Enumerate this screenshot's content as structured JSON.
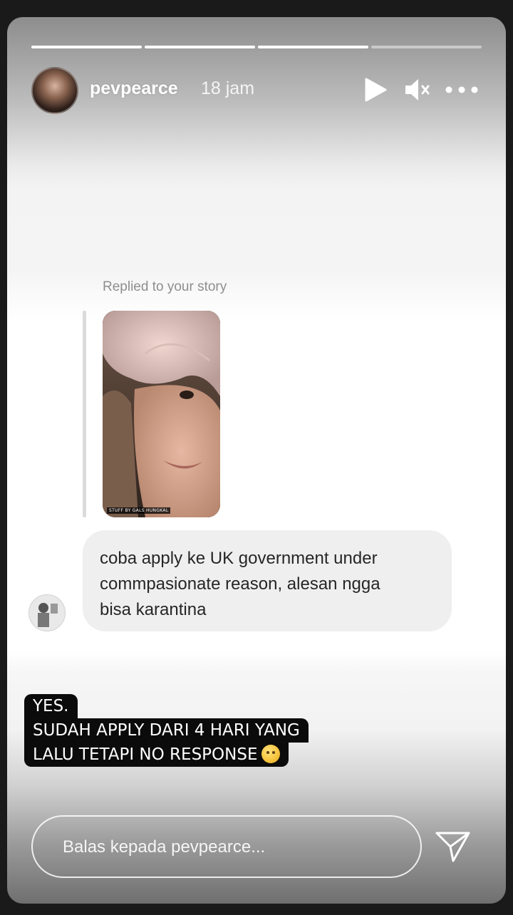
{
  "story": {
    "progress_segments": [
      {
        "state": "done"
      },
      {
        "state": "done"
      },
      {
        "state": "done"
      },
      {
        "state": "pending"
      }
    ],
    "username": "pevpearce",
    "time_ago": "18 jam",
    "icons": {
      "play": "play-icon",
      "mute": "speaker-muted-icon",
      "more": "more-options-icon",
      "send": "send-paper-plane-icon"
    }
  },
  "reply_context": {
    "label": "Replied to your story",
    "thumbnail_credit": "STUFF BY GALS HUNGKAL"
  },
  "dm": {
    "message_lines": [
      "coba apply ke UK government under",
      "commpasionate reason, alesan ngga",
      "bisa karantina"
    ]
  },
  "caption": {
    "lines": [
      "YES.",
      "SUDAH APPLY DARI 4 HARI YANG",
      "LALU TETAPI NO RESPONSE"
    ],
    "emoji": "sad-smile-emoji"
  },
  "reply_bar": {
    "placeholder": "Balas kepada pevpearce..."
  }
}
